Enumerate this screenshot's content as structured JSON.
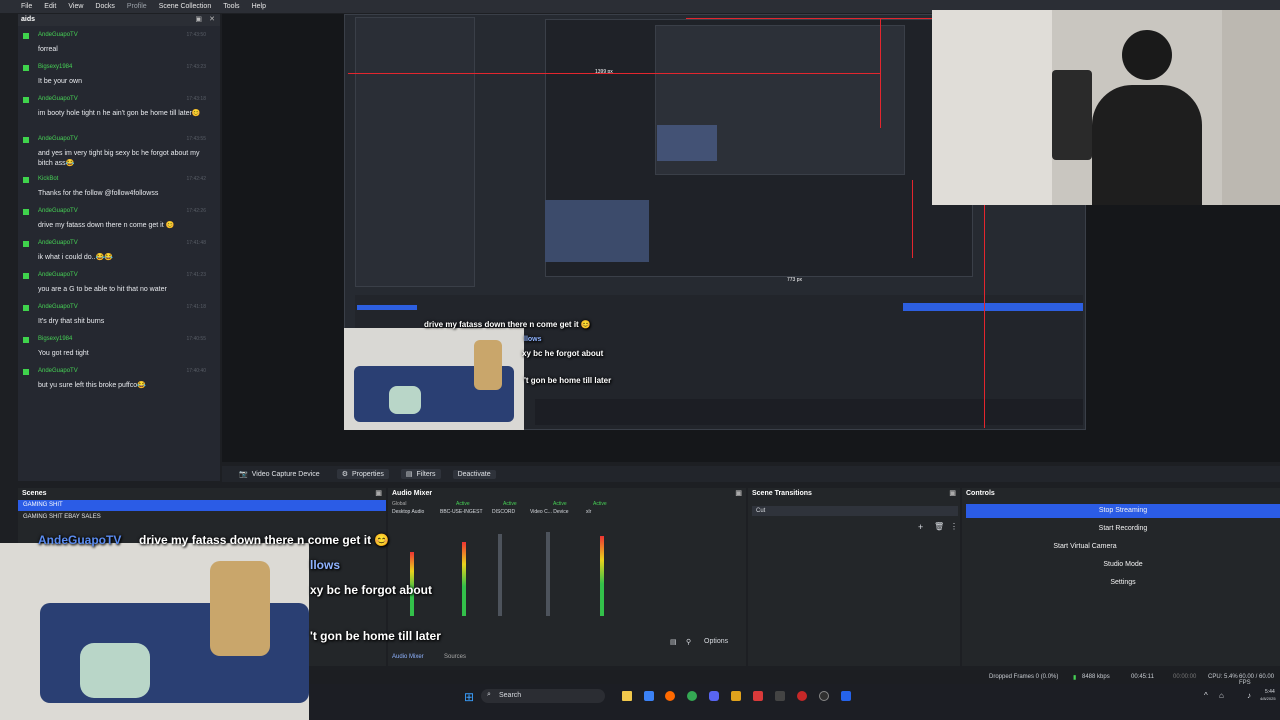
{
  "menubar": {
    "items": [
      "File",
      "Edit",
      "View",
      "Docks",
      "Profile",
      "Scene Collection",
      "Tools",
      "Help"
    ]
  },
  "chat": {
    "title": "aids",
    "messages": [
      {
        "user": "AndeGuapoTV",
        "time": "17:43:50",
        "text": "forreal"
      },
      {
        "user": "Bigsexy1984",
        "time": "17:43:23",
        "text": "It be your own"
      },
      {
        "user": "AndeGuapoTV",
        "time": "17:43:18",
        "text": "im booty hole tight n he ain't gon be home till later😊"
      },
      {
        "user": "AndeGuapoTV",
        "time": "17:43:55",
        "text": "and yes im very tight big sexy bc he forgot about my bitch ass😂"
      },
      {
        "user": "KickBot",
        "time": "17:42:42",
        "text": "Thanks for the follow @follow4followss"
      },
      {
        "user": "AndeGuapoTV",
        "time": "17:42:26",
        "text": "drive my fatass down there n come get it 😊"
      },
      {
        "user": "AndeGuapoTV",
        "time": "17:41:48",
        "text": "ik what i could do..😂😂"
      },
      {
        "user": "AndeGuapoTV",
        "time": "17:41:23",
        "text": "you are a G to be able to hit that no water"
      },
      {
        "user": "AndeGuapoTV",
        "time": "17:41:18",
        "text": "It's dry that shit burns"
      },
      {
        "user": "Bigsexy1984",
        "time": "17:40:55",
        "text": "You got red tight"
      },
      {
        "user": "AndeGuapoTV",
        "time": "17:40:40",
        "text": "but yu sure left this broke puffco😂"
      }
    ]
  },
  "preview": {
    "measure_1": "1399 px",
    "measure_2": "773 px"
  },
  "overlay": {
    "line1": "drive my fatass down there n come get it 😊",
    "line1_user": "AndeGuapoTV",
    "line2": "llows",
    "line3": "xy bc he forgot about",
    "line4": "'t gon be home till later"
  },
  "source_bar": {
    "source": "Video Capture Device",
    "properties": "Properties",
    "filters": "Filters",
    "deactivate": "Deactivate"
  },
  "scenes": {
    "title": "Scenes",
    "items": [
      "GAMING SHIT",
      "GAMING SHIT EBAY SALES"
    ]
  },
  "mixer": {
    "title": "Audio Mixer",
    "channels": [
      {
        "name": "Desktop Audio",
        "state": "Global"
      },
      {
        "name": "BBC-USE-INGEST",
        "state": "Active"
      },
      {
        "name": "DISCORD",
        "state": "Active"
      },
      {
        "name": "Video C... Device",
        "state": "Active"
      },
      {
        "name": "xlr",
        "state": "Active"
      }
    ],
    "options": "Options",
    "tab_mixer": "Audio Mixer",
    "tab_sources": "Sources"
  },
  "transitions": {
    "title": "Scene Transitions",
    "value": "Cut"
  },
  "controls": {
    "title": "Controls",
    "stop_streaming": "Stop Streaming",
    "start_recording": "Start Recording",
    "start_virtual": "Start Virtual Camera",
    "studio_mode": "Studio Mode",
    "settings": "Settings"
  },
  "status": {
    "dropped": "Dropped Frames 0 (0.0%)",
    "bitrate": "8488 kbps",
    "stream_time": "00:45:11",
    "rec_time": "00:00:00",
    "cpu": "CPU: 5.4%",
    "fps": "60.00 / 60.00 FPS"
  },
  "taskbar": {
    "search": "Search",
    "time": "5:44",
    "date": "4/8/2025"
  },
  "colors": {
    "accent": "#2b5ce6",
    "chat_user": "#46d155",
    "red_guide": "#e3262e"
  }
}
